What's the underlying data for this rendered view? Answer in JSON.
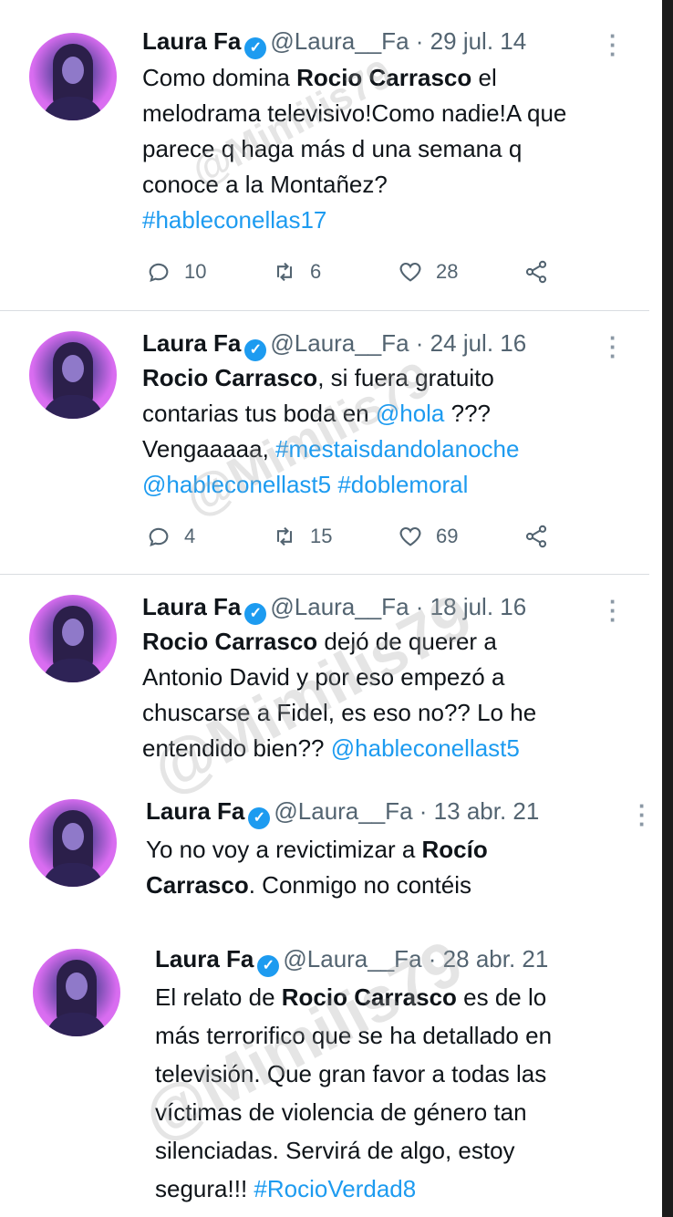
{
  "watermark": "@Mimilis79",
  "tweets": [
    {
      "name": "Laura Fa",
      "handle": "@Laura__Fa",
      "dot": "·",
      "date": "29 jul. 14",
      "lines": [
        [
          {
            "t": "Como domina "
          },
          {
            "t": "Rocio Carrasco",
            "b": true
          },
          {
            "t": " el"
          }
        ],
        [
          {
            "t": "melodrama televisivo!Como nadie!A que"
          }
        ],
        [
          {
            "t": "parece q haga más d una semana q"
          }
        ],
        [
          {
            "t": "conoce a la Montañez?"
          }
        ],
        [
          {
            "t": "#hableconellas17",
            "link": true
          }
        ]
      ],
      "reply_count": "10",
      "retweet_count": "6",
      "like_count": "28"
    },
    {
      "name": "Laura Fa",
      "handle": "@Laura__Fa",
      "dot": "·",
      "date": "24 jul. 16",
      "lines": [
        [
          {
            "t": "Rocio Carrasco",
            "b": true
          },
          {
            "t": ", si fuera gratuito"
          }
        ],
        [
          {
            "t": "contarias tus boda en "
          },
          {
            "t": "@hola",
            "link": true
          },
          {
            "t": " ???"
          }
        ],
        [
          {
            "t": "Vengaaaaa, "
          },
          {
            "t": "#mestaisdandolanoche",
            "link": true
          }
        ],
        [
          {
            "t": "@hableconellast5",
            "link": true
          },
          {
            "t": " "
          },
          {
            "t": "#doblemoral",
            "link": true
          }
        ]
      ],
      "reply_count": "4",
      "retweet_count": "15",
      "like_count": "69"
    },
    {
      "name": "Laura Fa",
      "handle": "@Laura__Fa",
      "dot": "·",
      "date": "18 jul. 16",
      "lines": [
        [
          {
            "t": "Rocio Carrasco",
            "b": true
          },
          {
            "t": " dejó de querer a"
          }
        ],
        [
          {
            "t": "Antonio David y por eso empezó a"
          }
        ],
        [
          {
            "t": "chuscarse a Fidel, es eso no?? Lo he"
          }
        ],
        [
          {
            "t": "entendido bien?? "
          },
          {
            "t": "@hableconellast5",
            "link": true
          }
        ]
      ]
    },
    {
      "name": "Laura Fa",
      "handle": "@Laura__Fa",
      "dot": "·",
      "date": "13 abr. 21",
      "lines": [
        [
          {
            "t": "Yo no voy a revictimizar a "
          },
          {
            "t": "Rocío",
            "b": true
          }
        ],
        [
          {
            "t": "Carrasco",
            "b": true
          },
          {
            "t": ". Conmigo no contéis"
          }
        ]
      ]
    },
    {
      "name": "Laura Fa",
      "handle": "@Laura__Fa",
      "dot": "·",
      "date": "28 abr. 21",
      "lines": [
        [
          {
            "t": "El relato de "
          },
          {
            "t": "Rocio Carrasco",
            "b": true
          },
          {
            "t": " es de lo"
          }
        ],
        [
          {
            "t": "más terrorifico que se ha detallado en"
          }
        ],
        [
          {
            "t": "televisión. Que gran favor a todas las"
          }
        ],
        [
          {
            "t": "víctimas de violencia de género tan"
          }
        ],
        [
          {
            "t": "silenciadas. Servirá de algo, estoy"
          }
        ],
        [
          {
            "t": "segura!!! "
          },
          {
            "t": "#RocioVerdad8",
            "link": true
          }
        ]
      ]
    }
  ],
  "colors": {
    "link": "#1d9bf0",
    "verified": "#1d9bf0",
    "muted": "#536471"
  },
  "icons": {
    "verified": "verified-badge-icon",
    "reply": "reply-bubble-icon",
    "retweet": "retweet-icon",
    "like": "heart-icon",
    "share": "share-icon",
    "more": "more-vertical-icon"
  }
}
